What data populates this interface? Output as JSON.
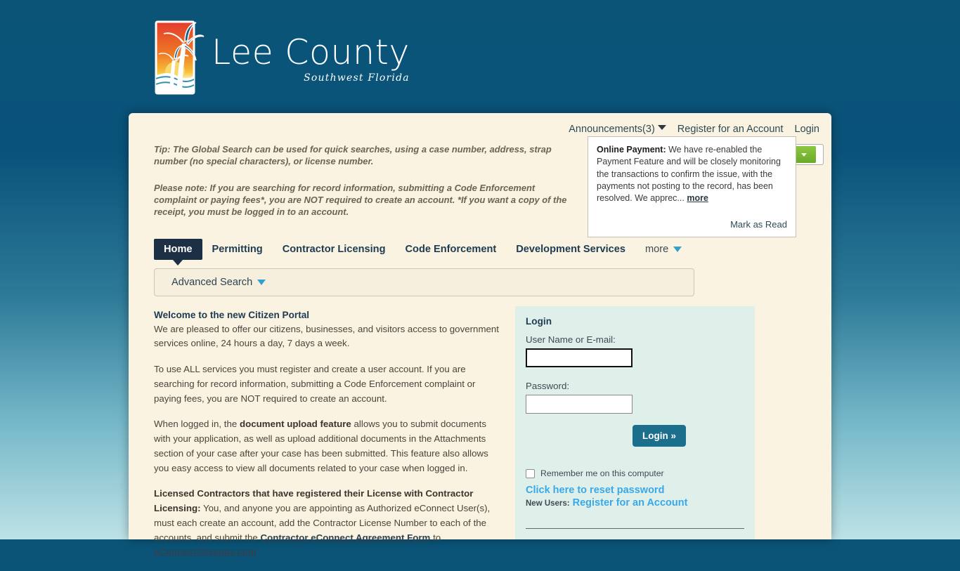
{
  "brand": {
    "title": "Lee County",
    "subtitle": "Southwest Florida",
    "logo_icon": "palm-tree-sunset-logo"
  },
  "top_links": {
    "announcements": "Announcements(3)",
    "register": "Register for an Account",
    "login": "Login"
  },
  "announcement": {
    "heading": "Online Payment:",
    "body": " We have re-enabled the Payment Feature and will be closely monitoring the transactions to confirm the issue, with the payments not posting to the record, has been resolved. We apprec...",
    "more": "more",
    "mark_as_read": "Mark as Read"
  },
  "tips": {
    "tip1": "Tip: The Global Search can be used for quick searches, using a case number, address, strap number (no special characters), or license number.",
    "tip2": "Please note: If you are searching for record information, submitting a Code Enforcement complaint or paying fees*, you are NOT required to create an account.  *If you want a copy of the receipt, you must be logged in to an account."
  },
  "nav": {
    "items": [
      {
        "label": "Home",
        "active": true
      },
      {
        "label": "Permitting",
        "active": false
      },
      {
        "label": "Contractor Licensing",
        "active": false
      },
      {
        "label": "Code Enforcement",
        "active": false
      },
      {
        "label": "Development Services",
        "active": false
      }
    ],
    "more_label": "more"
  },
  "search": {
    "advanced_label": "Advanced Search"
  },
  "content": {
    "heading": "Welcome to the new Citizen Portal",
    "para1": "We are pleased to offer our citizens, businesses, and visitors access to government services online, 24 hours a day, 7 days a week.",
    "para2": "To use ALL services you must register and create a user account. If you are searching for record information, submitting a Code Enforcement complaint or paying fees, you are NOT required to create an account.",
    "para3_a": "When logged in, the ",
    "para3_bold": "document upload feature",
    "para3_b": " allows you to submit documents with your application, as well as upload additional documents in the Attachments section of your case after your case has been submitted. This feature also allows you easy access to view all documents related to your case when logged in.",
    "para4_bold": "Licensed Contractors that have registered their License with Contractor Licensing:",
    "para4_a": " You, and anyone you are appointing as Authorized eConnect User(s), must each create an account, add the Contractor License Number to each of the accounts, and submit the ",
    "para4_link1": "Contractor eConnect Agreement Form",
    "para4_mid": " to ",
    "para4_link2": "eConnect@leegov.com"
  },
  "login": {
    "title": "Login",
    "username_label": "User Name or E-mail:",
    "username_value": "",
    "username_placeholder": "",
    "password_label": "Password:",
    "password_value": "",
    "password_placeholder": "",
    "submit_label": "Login »",
    "remember_label": "Remember me on this computer",
    "reset_link": "Click here to reset password",
    "new_users_label": "New Users:",
    "register_link": "Register for an Account"
  },
  "colors": {
    "page_bg_top": "#0b5478",
    "page_bg_bottom": "#bde2e6",
    "panel_bg": "#faf3e1",
    "nav_active_bg": "#1d2f44",
    "login_panel_bg": "#dff0eb",
    "login_button_bg": "#1b6f8c",
    "link_blue": "#3aa8e8",
    "caret_blue": "#2f9fd4",
    "green_widget": "#8cc63f"
  }
}
